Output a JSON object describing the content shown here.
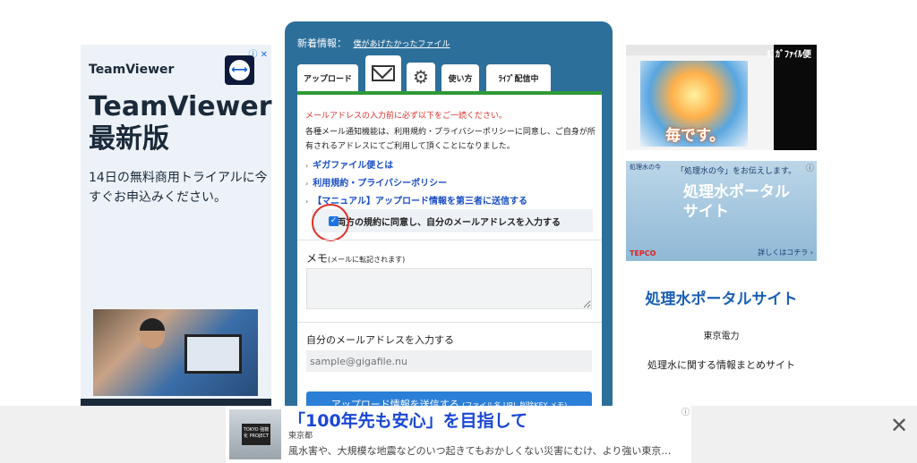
{
  "left_ad": {
    "adchoices": "ⓘ ✕",
    "brand": "TeamViewer",
    "headline": "TeamViewer 最新版",
    "copy": "14日の無料商用トライアルに今すぐお申込みください。"
  },
  "panel": {
    "news_label": "新着情報：",
    "news_link": "僕があげたかったファイル",
    "tabs": {
      "upload": "アップロード",
      "usage": "使い方",
      "live": "ﾗｲﾌﾞ配信中"
    },
    "warning": "メールアドレスの入力前に必ず以下をご一読ください。",
    "description": "各種メール通知機能は、利用規約・プライバシーポリシーに同意し、ご自身が所有されるアドレスにてご利用して頂くことになりました。",
    "links": [
      "ギガファイル便とは",
      "利用規約・プライバシーポリシー",
      "【マニュアル】アップロード情報を第三者に送信する"
    ],
    "agree_checked": true,
    "agree_label": "両方の規約に同意し、自分のメールアドレスを入力する",
    "memo_label": "メモ",
    "memo_note": "(メールに転記されます)",
    "email_label": "自分のメールアドレスを入力する",
    "email_placeholder": "sample@gigafile.nu",
    "submit_label": "アップロード情報を送信する",
    "submit_note": "(ファイル名,URL,削除KEY,メモ)"
  },
  "right_video_ad": {
    "caption": "毎です。",
    "top_caption": "ｷﾞｶﾞﾌｧｲﾙ便"
  },
  "right_banner_ad": {
    "badge": "処理水の今",
    "top_text": "「処理水の今」をお伝えします。",
    "big_text": "処理水ポータルサイト",
    "logo": "TEPCO",
    "more": "詳しくはコチラ ›"
  },
  "right_text_ad": {
    "title": "処理水ポータルサイト",
    "sponsor": "東京電力",
    "description": "処理水に関する情報まとめサイト"
  },
  "bottom_ad": {
    "thumb_tag": "TOKYO 強靭化 PROJECT",
    "headline": "「100年先も安心」を目指して",
    "sponsor": "東京都",
    "body": "風水害や、大規模な地震などのいつ起きてもおかしくない災害にむけ、より強い東京…",
    "close": "✕"
  },
  "colors": {
    "panel_blue": "#2d6f9b",
    "accent_green": "#2f9a35",
    "warning_red": "#d9322a",
    "link_blue": "#1a4ec4",
    "submit_blue": "#2c7fd6"
  }
}
